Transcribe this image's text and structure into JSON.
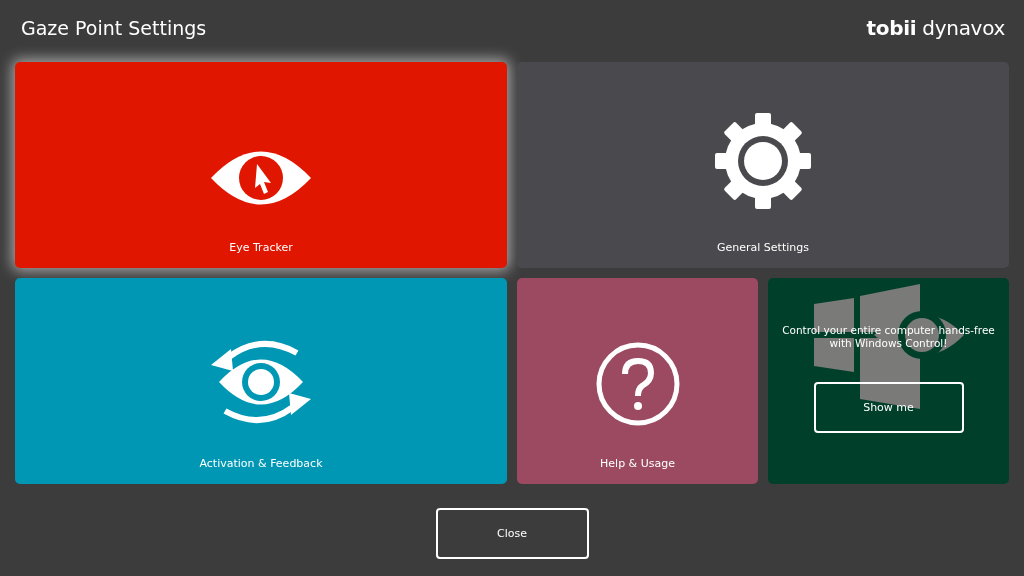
{
  "window": {
    "title": "Gaze Point Settings"
  },
  "logo": "**tobii** dynavox",
  "tiles": [
    {
      "kind": "eye-tracker",
      "label": "Eye Tracker",
      "color": "#e01600",
      "selected": true
    },
    {
      "kind": "general",
      "label": "General Settings",
      "color": "#4a4a4e",
      "selected": false
    },
    {
      "kind": "activation",
      "label": "Activation & Feedback",
      "color": "#0097b4",
      "selected": false
    },
    {
      "kind": "help",
      "label": "Help & Usage",
      "color": "#9c4a62",
      "selected": false
    }
  ],
  "promo": {
    "text": "Control your entire computer hands-free with Windows Control!",
    "button": "Show me"
  },
  "close_button": "Close"
}
